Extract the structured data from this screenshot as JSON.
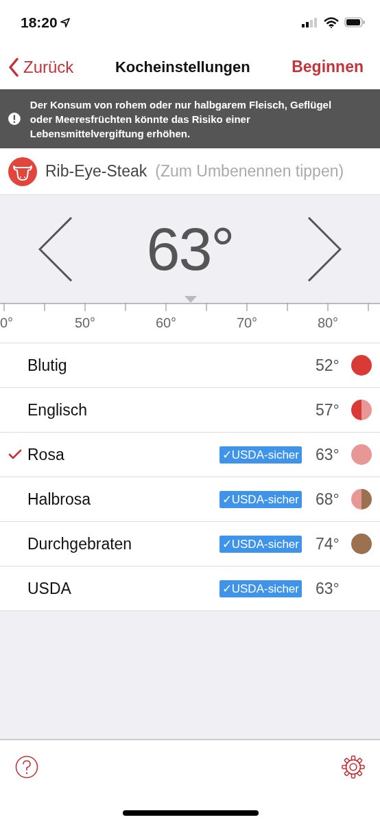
{
  "status_bar": {
    "time": "18:20"
  },
  "nav": {
    "back": "Zurück",
    "title": "Kocheinstellungen",
    "action": "Beginnen"
  },
  "warning": {
    "text": "Der Konsum von rohem oder nur halbgarem Fleisch, Geflügel oder Meeresfrüchten könnte das Risiko einer Lebensmittelvergiftung erhöhen."
  },
  "meat": {
    "name": "Rib-Eye-Steak",
    "hint": "(Zum Umbenennen tippen)"
  },
  "picker": {
    "value": "63°",
    "scale_labels": [
      "0°",
      "50°",
      "60°",
      "70°",
      "80°"
    ]
  },
  "doneness": [
    {
      "label": "Blutig",
      "selected": false,
      "temp": "52°",
      "dot": [
        {
          "color": "#d93a36"
        }
      ]
    },
    {
      "label": "Englisch",
      "selected": false,
      "temp": "57°",
      "dot": [
        {
          "color": "#d93a36"
        },
        {
          "color": "#e79896"
        }
      ]
    },
    {
      "label": "Rosa",
      "selected": true,
      "badge": "✓USDA-sicher",
      "temp": "63°",
      "dot": [
        {
          "color": "#e79896"
        }
      ]
    },
    {
      "label": "Halbrosa",
      "selected": false,
      "badge": "✓USDA-sicher",
      "temp": "68°",
      "dot": [
        {
          "color": "#e79896"
        },
        {
          "color": "#9c7150"
        }
      ]
    },
    {
      "label": "Durchgebraten",
      "selected": false,
      "badge": "✓USDA-sicher",
      "temp": "74°",
      "dot": [
        {
          "color": "#9c7150"
        }
      ]
    },
    {
      "label": "USDA",
      "selected": false,
      "badge": "✓USDA-sicher",
      "temp": "63°"
    }
  ]
}
